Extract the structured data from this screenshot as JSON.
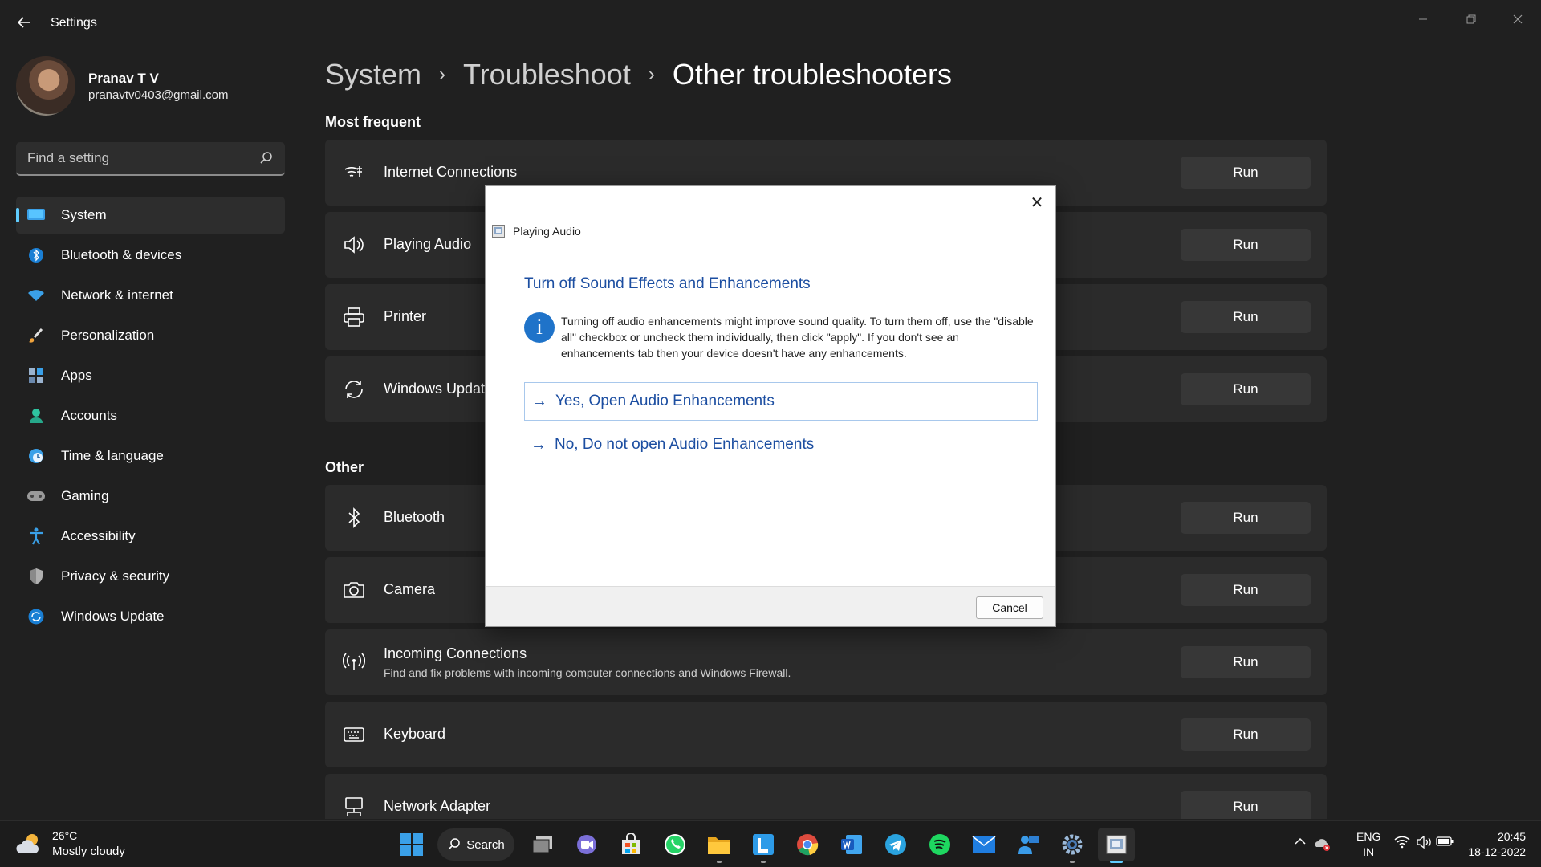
{
  "window": {
    "title": "Settings",
    "back_icon": "back-arrow-icon",
    "minimize_icon": "minimize-icon",
    "restore_icon": "restore-icon",
    "close_icon": "close-icon"
  },
  "profile": {
    "name": "Pranav T V",
    "email": "pranavtv0403@gmail.com"
  },
  "search": {
    "placeholder": "Find a setting"
  },
  "sidebar": {
    "items": [
      {
        "label": "System",
        "icon": "monitor-icon",
        "active": true
      },
      {
        "label": "Bluetooth & devices",
        "icon": "bluetooth-icon"
      },
      {
        "label": "Network & internet",
        "icon": "wifi-icon"
      },
      {
        "label": "Personalization",
        "icon": "brush-icon"
      },
      {
        "label": "Apps",
        "icon": "apps-icon"
      },
      {
        "label": "Accounts",
        "icon": "person-icon"
      },
      {
        "label": "Time & language",
        "icon": "globe-clock-icon"
      },
      {
        "label": "Gaming",
        "icon": "gamepad-icon"
      },
      {
        "label": "Accessibility",
        "icon": "accessibility-icon"
      },
      {
        "label": "Privacy & security",
        "icon": "shield-icon"
      },
      {
        "label": "Windows Update",
        "icon": "update-icon"
      }
    ]
  },
  "breadcrumb": {
    "part1": "System",
    "part2": "Troubleshoot",
    "current": "Other troubleshooters",
    "separator": "›"
  },
  "sections": {
    "most_frequent": "Most frequent",
    "other": "Other"
  },
  "troubleshooters": {
    "run_label": "Run",
    "most_frequent": [
      {
        "title": "Internet Connections",
        "icon": "wifi-signal-icon"
      },
      {
        "title": "Playing Audio",
        "icon": "speaker-icon"
      },
      {
        "title": "Printer",
        "icon": "printer-icon"
      },
      {
        "title": "Windows Update",
        "icon": "sync-icon"
      }
    ],
    "other": [
      {
        "title": "Bluetooth",
        "icon": "bluetooth-icon"
      },
      {
        "title": "Camera",
        "icon": "camera-icon"
      },
      {
        "title": "Incoming Connections",
        "desc": "Find and fix problems with incoming computer connections and Windows Firewall.",
        "icon": "antenna-icon"
      },
      {
        "title": "Keyboard",
        "icon": "keyboard-icon"
      },
      {
        "title": "Network Adapter",
        "icon": "network-adapter-icon"
      }
    ]
  },
  "dialog": {
    "app_title": "Playing Audio",
    "heading": "Turn off Sound Effects and Enhancements",
    "info_text": "Turning off audio enhancements might improve sound quality. To turn them off, use the \"disable all\" checkbox or uncheck them individually, then click \"apply\". If you don't see an enhancements tab then your device doesn't have any enhancements.",
    "option_yes": "Yes, Open Audio Enhancements",
    "option_no": "No, Do not open Audio Enhancements",
    "cancel": "Cancel",
    "arrow": "→",
    "close": "✕",
    "info_glyph": "i"
  },
  "taskbar": {
    "weather_temp": "26°C",
    "weather_desc": "Mostly cloudy",
    "search_label": "Search",
    "lang_line1": "ENG",
    "lang_line2": "IN",
    "time": "20:45",
    "date": "18-12-2022",
    "apps": [
      "start-icon",
      "search-icon",
      "task-view-icon",
      "chat-icon",
      "store-icon",
      "whatsapp-icon",
      "file-explorer-icon",
      "l-app-icon",
      "chrome-icon",
      "word-icon",
      "telegram-icon",
      "spotify-icon",
      "mail-icon",
      "teams-icon",
      "settings-icon",
      "troubleshooter-icon"
    ]
  },
  "colors": {
    "accent": "#60cdff",
    "dialog_link": "#1c4ea1",
    "card_bg": "#2b2b2b",
    "background": "#202020"
  }
}
